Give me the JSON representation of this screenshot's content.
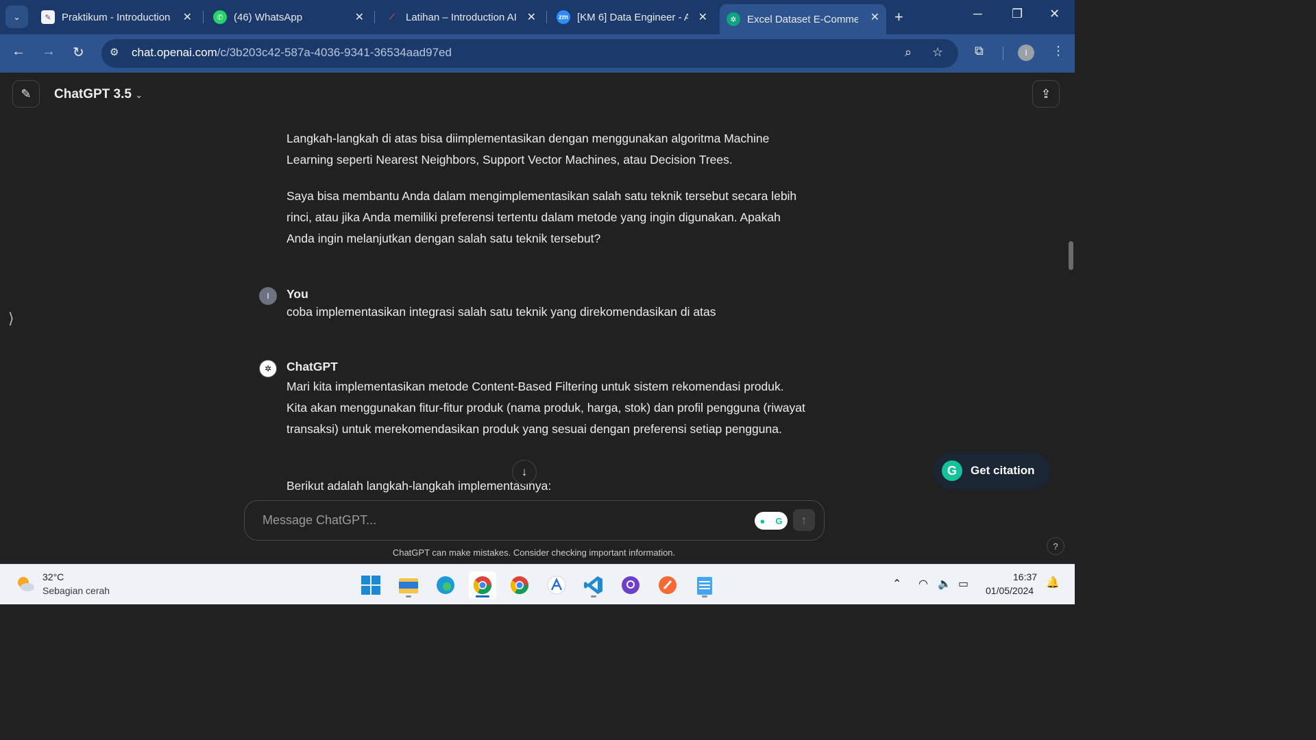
{
  "browser": {
    "tabs": [
      {
        "title": "Praktikum - Introduction",
        "favicon": "notepad-icon",
        "active": false
      },
      {
        "title": "(46) WhatsApp",
        "favicon": "whatsapp-icon",
        "active": false
      },
      {
        "title": "Latihan – Introduction AI",
        "favicon": "dicoding-icon",
        "active": false
      },
      {
        "title": "[KM 6] Data Engineer - A",
        "favicon": "zoom-icon",
        "favicon_text": "zm",
        "active": false
      },
      {
        "title": "Excel Dataset E-Commerce",
        "favicon": "openai-icon",
        "active": true
      }
    ],
    "url_domain": "chat.openai.com",
    "url_path": "/c/3b203c42-587a-4036-9341-36534aad97ed",
    "profile_initial": "I"
  },
  "chat": {
    "model_label": "ChatGPT 3.5",
    "messages": {
      "prev_p1": "Langkah-langkah di atas bisa diimplementasikan dengan menggunakan algoritma Machine Learning seperti Nearest Neighbors, Support Vector Machines, atau Decision Trees.",
      "prev_p2": "Saya bisa membantu Anda dalam mengimplementasikan salah satu teknik tersebut secara lebih rinci, atau jika Anda memiliki preferensi tertentu dalam metode yang ingin digunakan. Apakah Anda ingin melanjutkan dengan salah satu teknik tersebut?",
      "user_name": "You",
      "user_avatar": "I",
      "user_text": "coba implementasikan integrasi salah satu teknik yang direkomendasikan di atas",
      "gpt_name": "ChatGPT",
      "gpt_p1": "Mari kita implementasikan metode Content-Based Filtering untuk sistem rekomendasi produk. Kita akan menggunakan fitur-fitur produk (nama produk, harga, stok) dan profil pengguna (riwayat transaksi) untuk merekomendasikan produk yang sesuai dengan preferensi setiap pengguna.",
      "gpt_p2": "Berikut adalah langkah-langkah implementasinya:"
    },
    "composer_placeholder": "Message ChatGPT...",
    "disclaimer": "ChatGPT can make mistakes. Consider checking important information.",
    "citation_label": "Get citation",
    "help_label": "?"
  },
  "taskbar": {
    "weather_temp": "32°C",
    "weather_desc": "Sebagian cerah",
    "time": "16:37",
    "date": "01/05/2024"
  },
  "colors": {
    "tab_bar": "#1b3a6b",
    "toolbar": "#2d548f",
    "chat_bg": "#212121",
    "grammarly_green": "#15c39a"
  }
}
